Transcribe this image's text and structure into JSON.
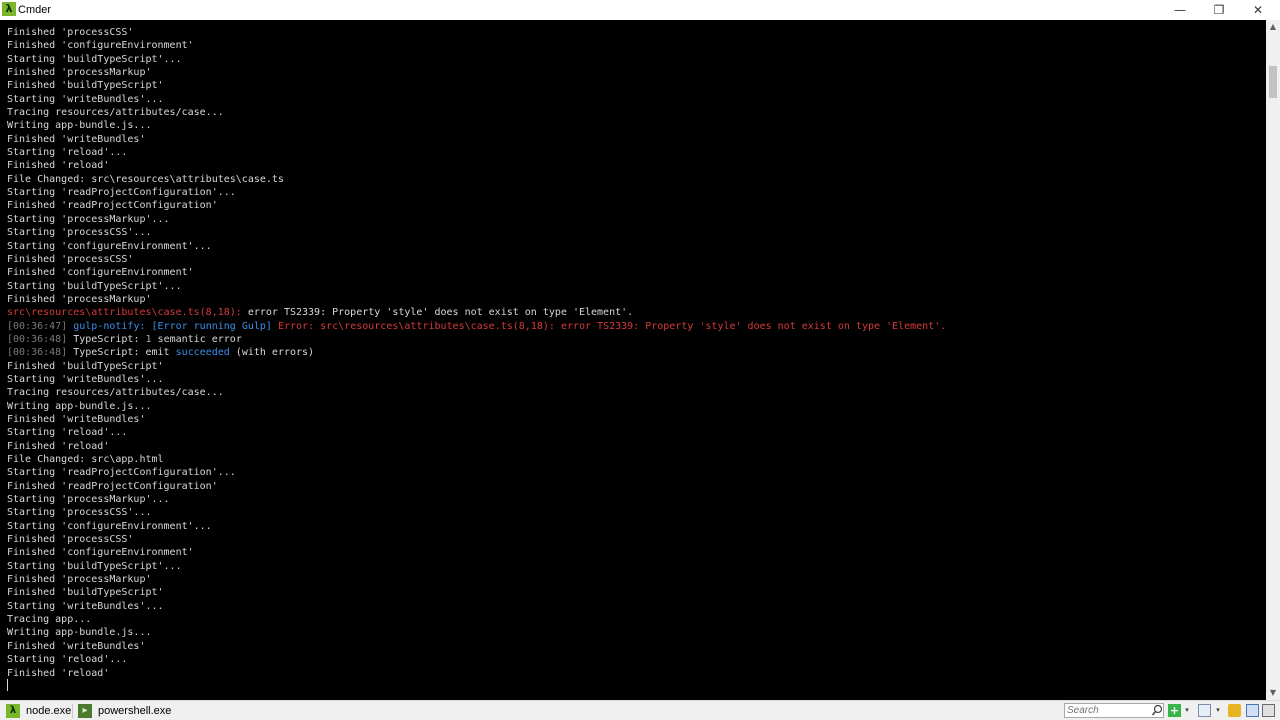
{
  "window": {
    "title": "Cmder",
    "app_icon": "λ"
  },
  "window_controls": {
    "minimize_icon": "minimize-icon",
    "maximize_icon": "restore-icon",
    "close_icon": "close-icon",
    "minimize": "—",
    "maximize": "❐",
    "close": "✕"
  },
  "terminal": {
    "colors": {
      "background": "#000000",
      "text": "#d8d8d8",
      "error": "#d63a3a",
      "timestamp": "#7a7a7a",
      "link": "#3a8ee6"
    },
    "lines": [
      [
        {
          "t": "Finished 'processCSS'",
          "c": ""
        }
      ],
      [
        {
          "t": "Finished 'configureEnvironment'",
          "c": ""
        }
      ],
      [
        {
          "t": "Starting 'buildTypeScript'...",
          "c": ""
        }
      ],
      [
        {
          "t": "Finished 'processMarkup'",
          "c": ""
        }
      ],
      [
        {
          "t": "Finished 'buildTypeScript'",
          "c": ""
        }
      ],
      [
        {
          "t": "Starting 'writeBundles'...",
          "c": ""
        }
      ],
      [
        {
          "t": "Tracing resources/attributes/case...",
          "c": ""
        }
      ],
      [
        {
          "t": "Writing app-bundle.js...",
          "c": ""
        }
      ],
      [
        {
          "t": "Finished 'writeBundles'",
          "c": ""
        }
      ],
      [
        {
          "t": "Starting 'reload'...",
          "c": ""
        }
      ],
      [
        {
          "t": "Finished 'reload'",
          "c": ""
        }
      ],
      [
        {
          "t": "File Changed: src\\resources\\attributes\\case.ts",
          "c": ""
        }
      ],
      [
        {
          "t": "Starting 'readProjectConfiguration'...",
          "c": ""
        }
      ],
      [
        {
          "t": "Finished 'readProjectConfiguration'",
          "c": ""
        }
      ],
      [
        {
          "t": "Starting 'processMarkup'...",
          "c": ""
        }
      ],
      [
        {
          "t": "Starting 'processCSS'...",
          "c": ""
        }
      ],
      [
        {
          "t": "Starting 'configureEnvironment'...",
          "c": ""
        }
      ],
      [
        {
          "t": "Finished 'processCSS'",
          "c": ""
        }
      ],
      [
        {
          "t": "Finished 'configureEnvironment'",
          "c": ""
        }
      ],
      [
        {
          "t": "Starting 'buildTypeScript'...",
          "c": ""
        }
      ],
      [
        {
          "t": "Finished 'processMarkup'",
          "c": ""
        }
      ],
      [
        {
          "t": "src\\resources\\attributes\\case.ts(8,18):",
          "c": "err"
        },
        {
          "t": " error TS2339: Property 'style' does not exist on type 'Element'.",
          "c": ""
        }
      ],
      [
        {
          "t": "[00:36:47]",
          "c": "time"
        },
        {
          "t": " gulp-notify: ",
          "c": "blue"
        },
        {
          "t": "[Error running Gulp]",
          "c": "blue"
        },
        {
          "t": " Error: src\\resources\\attributes\\case.ts(8,18): error TS2339: Property 'style' does not exist on type 'Element'.",
          "c": "err"
        }
      ],
      [
        {
          "t": "[00:36:48]",
          "c": "time"
        },
        {
          "t": " TypeScript: ",
          "c": ""
        },
        {
          "t": "1",
          "c": "num"
        },
        {
          "t": " semantic error",
          "c": ""
        }
      ],
      [
        {
          "t": "[00:36:48]",
          "c": "time"
        },
        {
          "t": " TypeScript: emit ",
          "c": ""
        },
        {
          "t": "succeeded",
          "c": "blue"
        },
        {
          "t": " (with errors)",
          "c": ""
        }
      ],
      [
        {
          "t": "Finished 'buildTypeScript'",
          "c": ""
        }
      ],
      [
        {
          "t": "Starting 'writeBundles'...",
          "c": ""
        }
      ],
      [
        {
          "t": "Tracing resources/attributes/case...",
          "c": ""
        }
      ],
      [
        {
          "t": "Writing app-bundle.js...",
          "c": ""
        }
      ],
      [
        {
          "t": "Finished 'writeBundles'",
          "c": ""
        }
      ],
      [
        {
          "t": "Starting 'reload'...",
          "c": ""
        }
      ],
      [
        {
          "t": "Finished 'reload'",
          "c": ""
        }
      ],
      [
        {
          "t": "File Changed: src\\app.html",
          "c": ""
        }
      ],
      [
        {
          "t": "Starting 'readProjectConfiguration'...",
          "c": ""
        }
      ],
      [
        {
          "t": "Finished 'readProjectConfiguration'",
          "c": ""
        }
      ],
      [
        {
          "t": "Starting 'processMarkup'...",
          "c": ""
        }
      ],
      [
        {
          "t": "Starting 'processCSS'...",
          "c": ""
        }
      ],
      [
        {
          "t": "Starting 'configureEnvironment'...",
          "c": ""
        }
      ],
      [
        {
          "t": "Finished 'processCSS'",
          "c": ""
        }
      ],
      [
        {
          "t": "Finished 'configureEnvironment'",
          "c": ""
        }
      ],
      [
        {
          "t": "Starting 'buildTypeScript'...",
          "c": ""
        }
      ],
      [
        {
          "t": "Finished 'processMarkup'",
          "c": ""
        }
      ],
      [
        {
          "t": "Finished 'buildTypeScript'",
          "c": ""
        }
      ],
      [
        {
          "t": "Starting 'writeBundles'...",
          "c": ""
        }
      ],
      [
        {
          "t": "Tracing app...",
          "c": ""
        }
      ],
      [
        {
          "t": "Writing app-bundle.js...",
          "c": ""
        }
      ],
      [
        {
          "t": "Finished 'writeBundles'",
          "c": ""
        }
      ],
      [
        {
          "t": "Starting 'reload'...",
          "c": ""
        }
      ],
      [
        {
          "t": "Finished 'reload'",
          "c": ""
        }
      ]
    ]
  },
  "scrollbar": {
    "up_icon": "scroll-up-icon",
    "down_icon": "scroll-down-icon",
    "up": "▲",
    "down": "▼"
  },
  "tabs": [
    {
      "label": "node.exe",
      "icon": "cmder-lambda-icon",
      "glyph": "λ"
    },
    {
      "label": "powershell.exe",
      "icon": "powershell-icon",
      "glyph": "▸"
    }
  ],
  "toolbar": {
    "search_placeholder": "Search",
    "search_icon": "search-icon",
    "add_glyph": "+",
    "dropdown_glyph": "▾"
  }
}
